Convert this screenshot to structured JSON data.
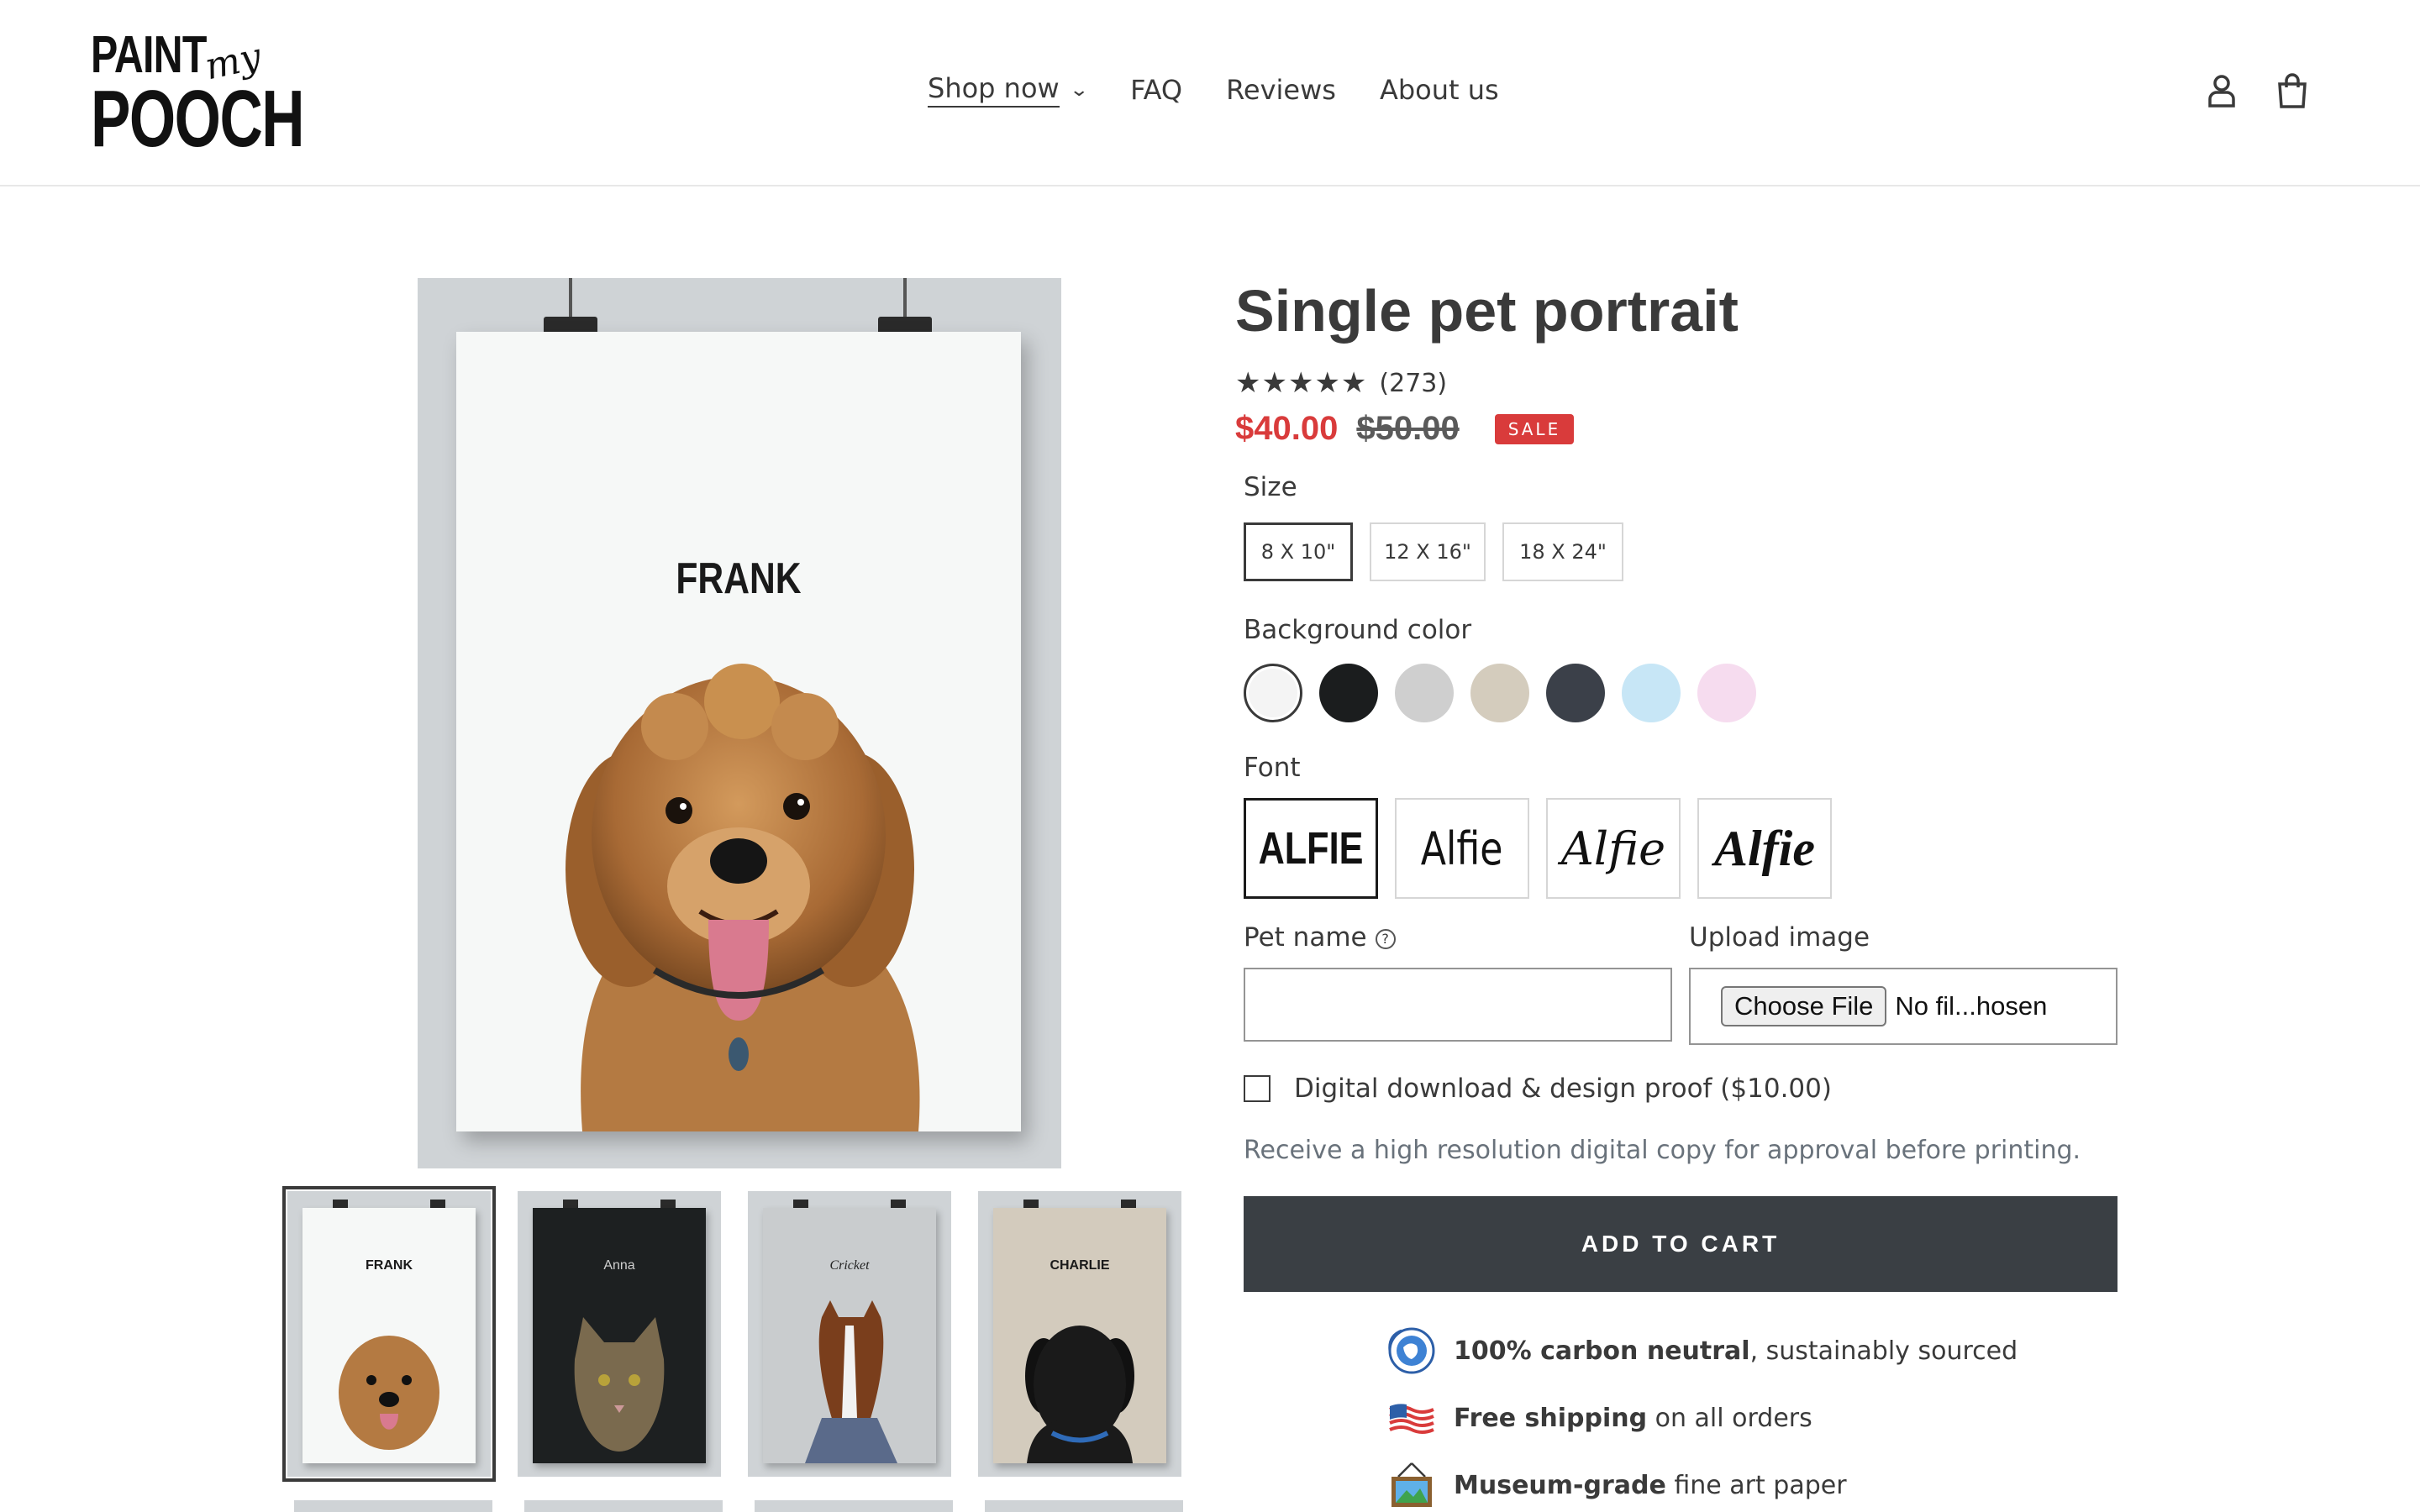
{
  "header": {
    "logo": {
      "line1": "PAINT",
      "script": "my",
      "line2": "POOCH"
    },
    "nav": [
      {
        "label": "Shop now"
      },
      {
        "label": "FAQ"
      },
      {
        "label": "Reviews"
      },
      {
        "label": "About us"
      }
    ],
    "icons": [
      "account-icon",
      "cart-icon"
    ]
  },
  "gallery": {
    "main_name": "FRANK",
    "thumbnails": [
      {
        "name": "FRANK",
        "bg": "#f6f8f7",
        "text": "#1a1a1a"
      },
      {
        "name": "Anna",
        "bg": "#1d2021",
        "text": "#cfcfcf"
      },
      {
        "name": "Cricket",
        "bg": "#c9ccce",
        "text": "#222222"
      },
      {
        "name": "CHARLIE",
        "bg": "#d3cbbd",
        "text": "#1a1a1a"
      }
    ]
  },
  "product": {
    "title": "Single pet portrait",
    "rating": {
      "stars": "★★★★★",
      "count": "(273)"
    },
    "price": {
      "sale": "$40.00",
      "original": "$50.00",
      "badge": "SALE"
    },
    "size": {
      "label": "Size",
      "options": [
        "8 X 10\"",
        "12 X 16\"",
        "18 X 24\""
      ],
      "selected": "8 X 10\""
    },
    "background": {
      "label": "Background color",
      "swatches": [
        "#f4f4f4",
        "#1b1d1e",
        "#cfcfcf",
        "#d4ccbd",
        "#3b4049",
        "#c7e6f6",
        "#f6dcef"
      ],
      "selected_index": 0
    },
    "font": {
      "label": "Font",
      "options": [
        "ALFIE",
        "Alfie",
        "Alfie",
        "Alfie"
      ],
      "selected_index": 0
    },
    "pet_name": {
      "label": "Pet name",
      "value": ""
    },
    "upload": {
      "label": "Upload image",
      "button": "Choose File",
      "status": "No fil...hosen"
    },
    "digital": {
      "label": "Digital download & design proof ($10.00)",
      "checked": false
    },
    "helper": "Receive a high resolution digital copy for approval before printing.",
    "add_to_cart": "ADD TO CART",
    "features": [
      {
        "bold": "100% carbon neutral",
        "rest": ", sustainably sourced",
        "icon": "eco-globe-icon"
      },
      {
        "bold": "Free shipping",
        "rest": " on all orders",
        "icon": "us-flag-icon"
      },
      {
        "bold": "Museum-grade",
        "rest": " fine art paper",
        "icon": "framed-landscape-icon"
      }
    ]
  }
}
